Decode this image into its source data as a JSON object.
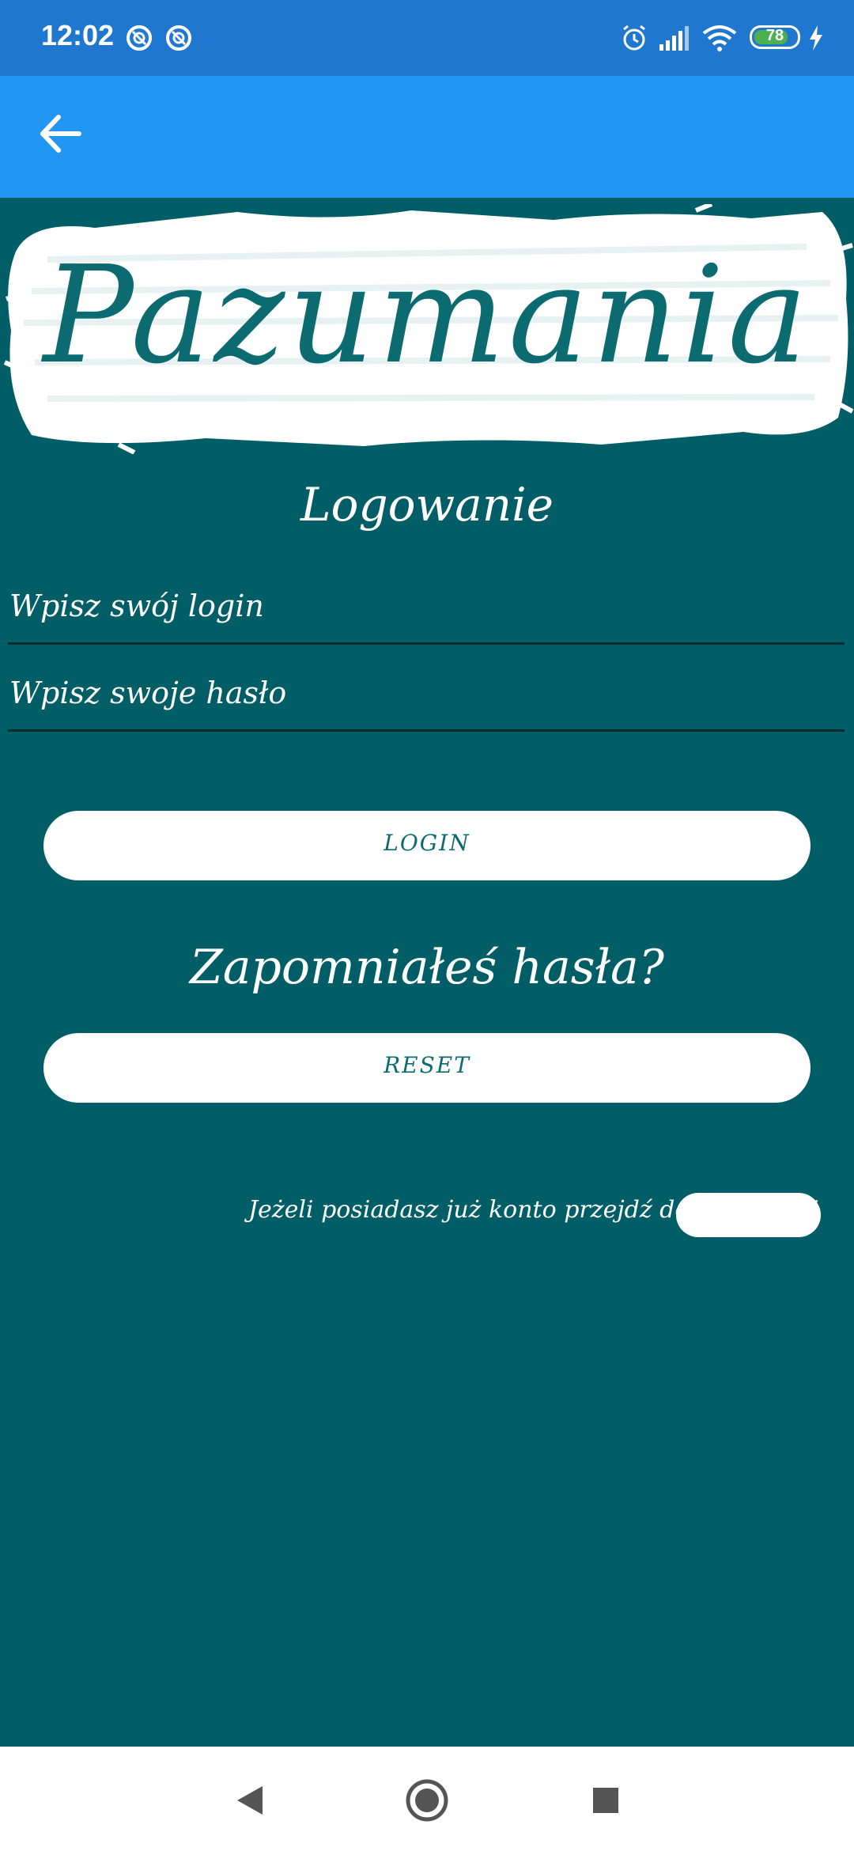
{
  "status_bar": {
    "time": "12:02",
    "battery": "78",
    "icons": [
      "notification-icon",
      "notification-icon",
      "alarm-icon",
      "signal-icon",
      "wifi-icon",
      "battery-icon",
      "charging-icon"
    ]
  },
  "app_bar": {
    "back_icon": "arrow-left-icon",
    "color": "#2196f3"
  },
  "header": {
    "logo_text": "Pazumania"
  },
  "form": {
    "heading": "Logowanie",
    "login_placeholder": "Wpisz swój login",
    "password_placeholder": "Wpisz swoje hasło",
    "login_button": "LOGIN",
    "forgot_text": "Zapomniałeś hasła?",
    "reset_button": "RESET",
    "register_text": "Jeżeli posiadasz już konto przejdź do rejestracji",
    "register_button": ""
  },
  "colors": {
    "background": "#025e66",
    "accent": "#0b6b70",
    "status_bar": "#1f77d0"
  },
  "nav_bar": {
    "icons": [
      "back-triangle-icon",
      "home-circle-icon",
      "recents-square-icon"
    ]
  }
}
